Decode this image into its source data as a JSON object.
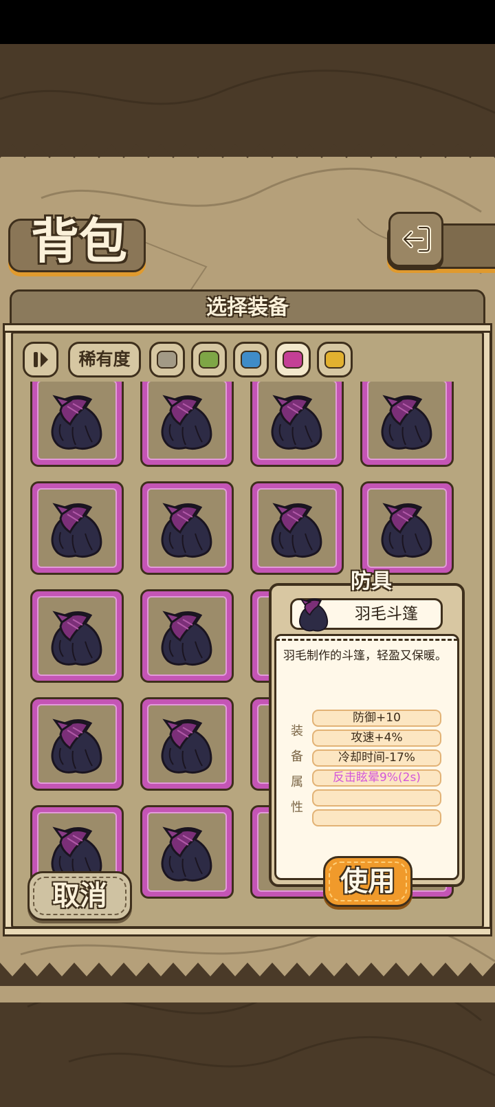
{
  "page_title": "背包",
  "dialog": {
    "title": "选择装备",
    "filter": {
      "sort_icon": "sort-toggle-icon",
      "rarity_label": "稀有度",
      "swatches": [
        {
          "name": "gray",
          "color": "#a29a86",
          "selected": false
        },
        {
          "name": "green",
          "color": "#7ea646",
          "selected": false
        },
        {
          "name": "blue",
          "color": "#3f8cc8",
          "selected": false
        },
        {
          "name": "purple",
          "color": "#c43f96",
          "selected": true
        },
        {
          "name": "gold",
          "color": "#e2b12f",
          "selected": false
        }
      ]
    },
    "grid": {
      "item_icon": "feather-cloak-icon",
      "rarity_color": "#c455b5",
      "rows": 5,
      "cols": 4
    },
    "cancel_label": "取消"
  },
  "tooltip": {
    "category": "防具",
    "item_name": "羽毛斗篷",
    "description": "羽毛制作的斗篷，轻盈又保暖。",
    "attr_labels": [
      "装",
      "备",
      "属",
      "性"
    ],
    "attributes": [
      "防御+10",
      "攻速+4%",
      "冷却时间-17%",
      "反击眩晕9%(2s)",
      "",
      ""
    ],
    "special_attr_color": "#d457d9",
    "use_label": "使用"
  },
  "icons": {
    "back": "back-arrow-icon"
  }
}
